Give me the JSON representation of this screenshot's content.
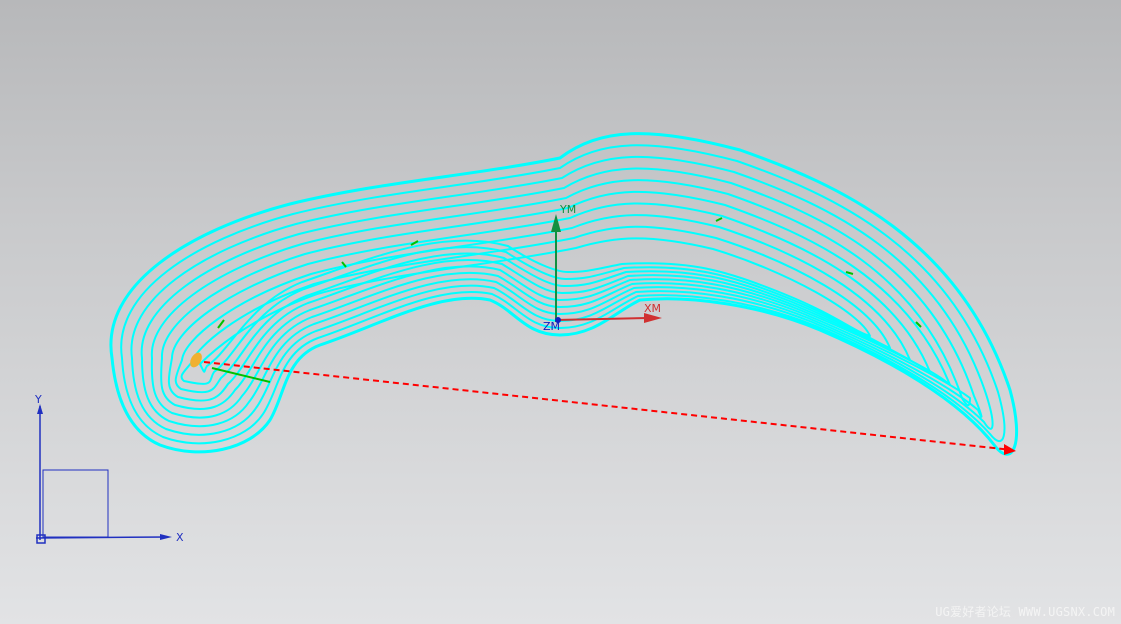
{
  "viewport": {
    "background_top": "#b7b8ba",
    "background_bottom": "#e2e3e5"
  },
  "toolpath": {
    "pass_color": "#00ffff",
    "engage_color": "#00c000",
    "entry_color": "#f0b030",
    "non_cut_color": "#ff0000"
  },
  "wcs": {
    "x_label": "XM",
    "y_label": "YM",
    "z_label": "ZM",
    "x_color": "#d03030",
    "y_color": "#109040",
    "z_color": "#1020c0"
  },
  "abs_csys": {
    "x_label": "X",
    "y_label": "Y",
    "color": "#2030c0"
  },
  "watermark": "UG爱好者论坛 WWW.UGSNX.COM"
}
